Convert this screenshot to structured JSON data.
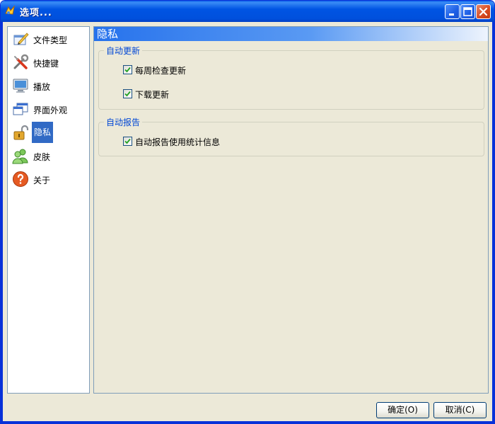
{
  "window": {
    "title": "选项...",
    "controls": [
      "minimize",
      "maximize",
      "close"
    ]
  },
  "sidebar": {
    "items": [
      {
        "label": "文件类型",
        "icon": "file-types-icon",
        "selected": false
      },
      {
        "label": "快捷键",
        "icon": "tools-icon",
        "selected": false
      },
      {
        "label": "播放",
        "icon": "monitor-icon",
        "selected": false
      },
      {
        "label": "界面外观",
        "icon": "windows-icon",
        "selected": false
      },
      {
        "label": "隐私",
        "icon": "lock-icon",
        "selected": true
      },
      {
        "label": "皮肤",
        "icon": "users-icon",
        "selected": false
      },
      {
        "label": "关于",
        "icon": "help-icon",
        "selected": false
      }
    ]
  },
  "content": {
    "section_title": "隐私",
    "groups": [
      {
        "title": "自动更新",
        "options": [
          {
            "label": "每周检查更新",
            "checked": true
          },
          {
            "label": "下载更新",
            "checked": true
          }
        ]
      },
      {
        "title": "自动报告",
        "options": [
          {
            "label": "自动报告使用统计信息",
            "checked": true
          }
        ]
      }
    ]
  },
  "buttons": {
    "ok": "确定(O)",
    "cancel": "取消(C)"
  },
  "colors": {
    "titlebar": "#0054e3",
    "selection": "#316ac5",
    "group_title": "#0046d5",
    "background": "#ece9d8"
  }
}
